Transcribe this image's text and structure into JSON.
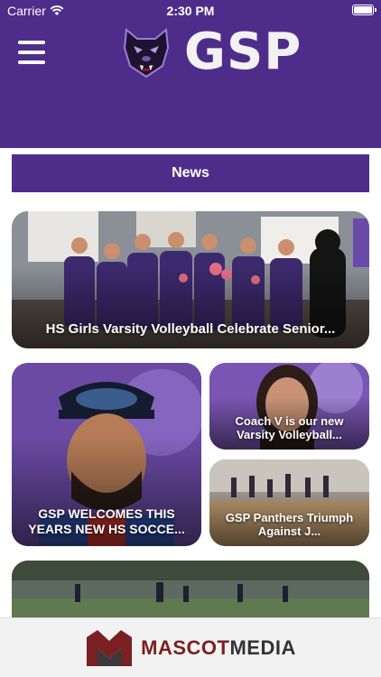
{
  "status_bar": {
    "carrier": "Carrier",
    "time": "2:30 PM"
  },
  "header": {
    "logo_text": "GSP",
    "icons": {
      "menu": "hamburger-menu-icon",
      "logo": "panther-head-icon"
    },
    "colors": {
      "brand": "#4e2d8a"
    }
  },
  "news": {
    "label": "News"
  },
  "articles": [
    {
      "title": "HS Girls Varsity Volleyball Celebrate Senior..."
    },
    {
      "title": "GSP WELCOMES THIS YEARS NEW HS SOCCE..."
    },
    {
      "title": "Coach V is our new Varsity Volleyball..."
    },
    {
      "title": "GSP Panthers Triumph Against J..."
    },
    {
      "title": ""
    }
  ],
  "footer": {
    "brand_part1": "MASCOT",
    "brand_part2": "MEDIA",
    "icons": {
      "logo": "mascot-media-m-icon"
    }
  }
}
